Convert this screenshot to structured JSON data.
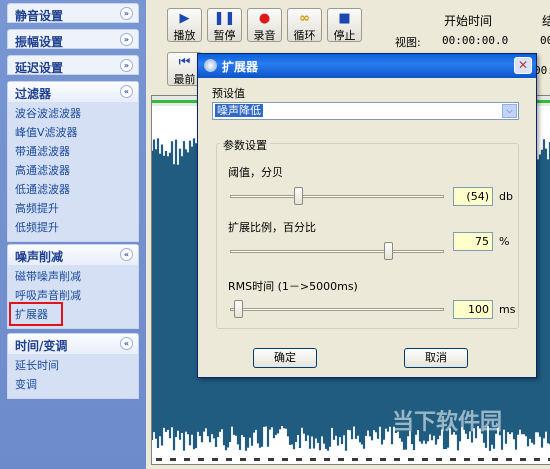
{
  "sidebar": {
    "collapsed": [
      {
        "label": "静音设置"
      },
      {
        "label": "振幅设置"
      },
      {
        "label": "延迟设置"
      }
    ],
    "filters": {
      "title": "过滤器",
      "items": [
        "波谷波滤波器",
        "峰值V滤波器",
        "带通滤波器",
        "高通滤波器",
        "低通滤波器",
        "高频提升",
        "低频提升"
      ]
    },
    "noise": {
      "title": "噪声削减",
      "items": [
        "磁带噪声削减",
        "呼吸声音削减",
        "扩展器"
      ]
    },
    "timevar": {
      "title": "时间/变调",
      "items": [
        "延长时间",
        "变调"
      ]
    }
  },
  "toolbar": {
    "play": "播放",
    "pause": "暂停",
    "record": "录音",
    "loop": "循环",
    "stop": "停止",
    "front": "最前"
  },
  "time": {
    "start_label": "开始时间",
    "cut_label": "结",
    "view_label": "视图:",
    "view_start": "00:00:00.0",
    "view_end": "00:",
    "select_end": "00:"
  },
  "dialog": {
    "title": "扩展器",
    "preset_label": "预设值",
    "preset_value": "噪声降低",
    "param_group": "参数设置",
    "threshold_label": "阈值，分贝",
    "threshold_value": "(54)",
    "threshold_unit": "db",
    "threshold_level": 0.31,
    "ratio_label": "扩展比例，百分比",
    "ratio_value": "75",
    "ratio_unit": "%",
    "ratio_level": 0.75,
    "rms_label": "RMS时间 (1－>5000ms)",
    "rms_value": "100",
    "rms_unit": "ms",
    "rms_level": 0.02,
    "ok": "确定",
    "cancel": "取消"
  },
  "watermark": "当下软件园",
  "colors": {
    "wave": "#1f5c80",
    "selection_outline": "#e3131b",
    "titlebar": "#0a5fd8"
  }
}
